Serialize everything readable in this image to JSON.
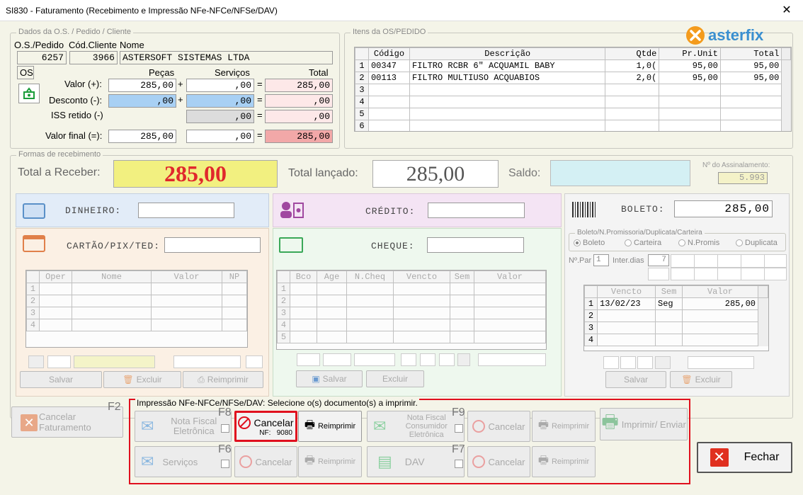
{
  "window": {
    "title": "SI830 - Faturamento (Recebimento e Impressão NFe-NFCe/NFSe/DAV)",
    "close": "✕"
  },
  "logo": {
    "text": "asterfix"
  },
  "os": {
    "group": "Dados da O.S. / Pedido / Cliente",
    "lbl_os": "O.S./Pedido",
    "lbl_cod": "Cód.Cliente",
    "lbl_nome": "Nome",
    "os_num": "6257",
    "cod": "3966",
    "nome": "ASTERSOFT SISTEMAS LTDA",
    "tipo": "OS",
    "h_pecas": "Peças",
    "h_serv": "Serviços",
    "h_total": "Total",
    "lbl_valor": "Valor (+):",
    "lbl_desc": "Desconto (-):",
    "lbl_iss": "ISS retido (-)",
    "lbl_final": "Valor final (=):",
    "valor_pecas": "285,00",
    "valor_serv": ",00",
    "valor_total": "285,00",
    "desc_pecas": ",00",
    "desc_serv": ",00",
    "desc_total": ",00",
    "iss_serv": ",00",
    "iss_total": ",00",
    "final_pecas": "285,00",
    "final_serv": ",00",
    "final_total": "285,00"
  },
  "itens": {
    "group": "Itens da OS/PEDIDO",
    "headers": [
      "Código",
      "Descrição",
      "Qtde",
      "Pr.Unit",
      "Total"
    ],
    "rows": [
      {
        "n": "1",
        "cod": "00347",
        "desc": "FILTRO RCBR 6\" ACQUAMIL BABY",
        "qtde": "1,0(",
        "unit": "95,00",
        "total": "95,00"
      },
      {
        "n": "2",
        "cod": "00113",
        "desc": "FILTRO MULTIUSO ACQUABIOS",
        "qtde": "2,0(",
        "unit": "95,00",
        "total": "95,00"
      },
      {
        "n": "3",
        "cod": "",
        "desc": "",
        "qtde": "",
        "unit": "",
        "total": ""
      },
      {
        "n": "4",
        "cod": "",
        "desc": "",
        "qtde": "",
        "unit": "",
        "total": ""
      },
      {
        "n": "5",
        "cod": "",
        "desc": "",
        "qtde": "",
        "unit": "",
        "total": ""
      },
      {
        "n": "6",
        "cod": "",
        "desc": "",
        "qtde": "",
        "unit": "",
        "total": ""
      }
    ]
  },
  "receb": {
    "group": "Formas de recebimento",
    "lbl_total": "Total a Receber:",
    "total": "285,00",
    "lbl_lancado": "Total lançado:",
    "lancado": "285,00",
    "lbl_saldo": "Saldo:",
    "lbl_assin": "Nº do Assinalamento:",
    "assin": "5.993"
  },
  "pay": {
    "dinheiro": "DINHEIRO:",
    "credito": "CRÉDITO:",
    "cartao": "CARTÃO/PIX/TED:",
    "cheque": "CHEQUE:",
    "boleto": "BOLETO:",
    "boleto_val": "285,00",
    "cartao_headers": [
      "Oper",
      "Nome",
      "Valor",
      "NP"
    ],
    "cheque_headers": [
      "Bco",
      "Age",
      "N.Cheq",
      "Vencto",
      "Sem",
      "Valor"
    ],
    "boleto_group": "Boleto/N.Promissoria/Duplicata/Carteira",
    "radios": [
      "Boleto",
      "Carteira",
      "N.Promis",
      "Duplicata"
    ],
    "lbl_npar": "Nº.Par",
    "npar": "1",
    "lbl_inter": "Inter.dias",
    "inter": "7",
    "boleto_headers": [
      "Vencto",
      "Sem",
      "Valor"
    ],
    "boleto_rows": [
      {
        "n": "1",
        "venc": "13/02/23",
        "sem": "Seg",
        "valor": "285,00"
      },
      {
        "n": "2",
        "venc": "",
        "sem": "",
        "valor": ""
      },
      {
        "n": "3",
        "venc": "",
        "sem": "",
        "valor": ""
      },
      {
        "n": "4",
        "venc": "",
        "sem": "",
        "valor": ""
      }
    ],
    "salvar": "Salvar",
    "excluir": "Excluir",
    "reimprimir": "Reimprimir"
  },
  "bottom": {
    "cancelar_fat": "Cancelar Faturamento",
    "f2": "F2",
    "imp_group": "Impressão NFe-NFCe/NFSe/DAV: Selecione o(s) documento(s) a imprimir.",
    "nfe": "Nota Fiscal Eletrônica",
    "f8": "F8",
    "nfce": "Nota Fiscal Consumidor Eletrônica",
    "f9": "F9",
    "servicos": "Serviços",
    "f6": "F6",
    "dav": "DAV",
    "f7": "F7",
    "cancelar": "Cancelar",
    "reimprimir": "Reimprimir",
    "nf_lbl": "NF:",
    "nf_num": "9080",
    "imprimir": "Imprimir/ Enviar",
    "fechar": "Fechar"
  }
}
